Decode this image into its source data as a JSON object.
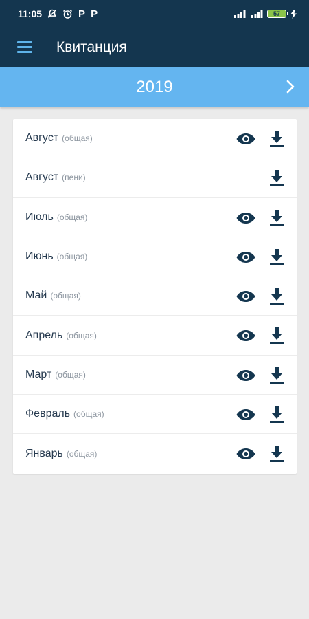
{
  "status_bar": {
    "time": "11:05",
    "battery": "57",
    "icons": [
      "mute-icon",
      "alarm-icon",
      "p-icon",
      "p-icon",
      "signal-icon",
      "signal-icon",
      "charging-icon"
    ],
    "p_glyph": "P"
  },
  "app_bar": {
    "title": "Квитанция",
    "menu_icon": "hamburger-menu-icon"
  },
  "year_bar": {
    "year": "2019",
    "next_icon": "chevron-right-icon"
  },
  "colors": {
    "primary_dark": "#14364f",
    "accent_blue": "#64b5f0",
    "icon_dark": "#14364f",
    "menu_icon": "#5fb4ea"
  },
  "receipts": [
    {
      "month": "Август",
      "kind": "(общая)",
      "has_view": true
    },
    {
      "month": "Август",
      "kind": "(пени)",
      "has_view": false
    },
    {
      "month": "Июль",
      "kind": "(общая)",
      "has_view": true
    },
    {
      "month": "Июнь",
      "kind": "(общая)",
      "has_view": true
    },
    {
      "month": "Май",
      "kind": "(общая)",
      "has_view": true
    },
    {
      "month": "Апрель",
      "kind": "(общая)",
      "has_view": true
    },
    {
      "month": "Март",
      "kind": "(общая)",
      "has_view": true
    },
    {
      "month": "Февраль",
      "kind": "(общая)",
      "has_view": true
    },
    {
      "month": "Январь",
      "kind": "(общая)",
      "has_view": true
    }
  ]
}
